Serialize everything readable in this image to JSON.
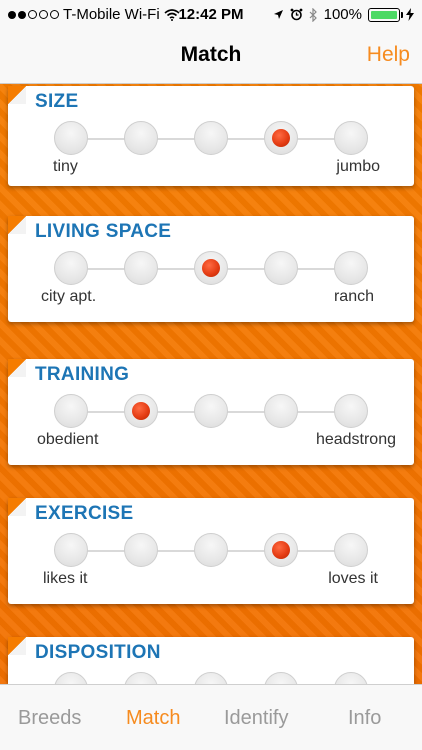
{
  "status": {
    "carrier": "T-Mobile Wi-Fi",
    "time": "12:42 PM",
    "battery": "100%"
  },
  "nav": {
    "title": "Match",
    "help": "Help"
  },
  "cards": [
    {
      "title": "SIZE",
      "left": "tiny",
      "right": "jumbo",
      "selected": 4
    },
    {
      "title": "LIVING SPACE",
      "left": "city apt.",
      "right": "ranch",
      "selected": 3
    },
    {
      "title": "TRAINING",
      "left": "obedient",
      "right": "headstrong",
      "selected": 2
    },
    {
      "title": "EXERCISE",
      "left": "likes it",
      "right": "loves it",
      "selected": 4
    },
    {
      "title": "DISPOSITION",
      "left": "",
      "right": "",
      "selected": 0
    }
  ],
  "tabs": [
    {
      "label": "Breeds",
      "active": false
    },
    {
      "label": "Match",
      "active": true
    },
    {
      "label": "Identify",
      "active": false
    },
    {
      "label": "Info",
      "active": false
    }
  ],
  "colors": {
    "accent": "#f68b1f",
    "heading": "#1d75b5",
    "selected_dot": "#e53d14",
    "background": "#f57c00"
  }
}
